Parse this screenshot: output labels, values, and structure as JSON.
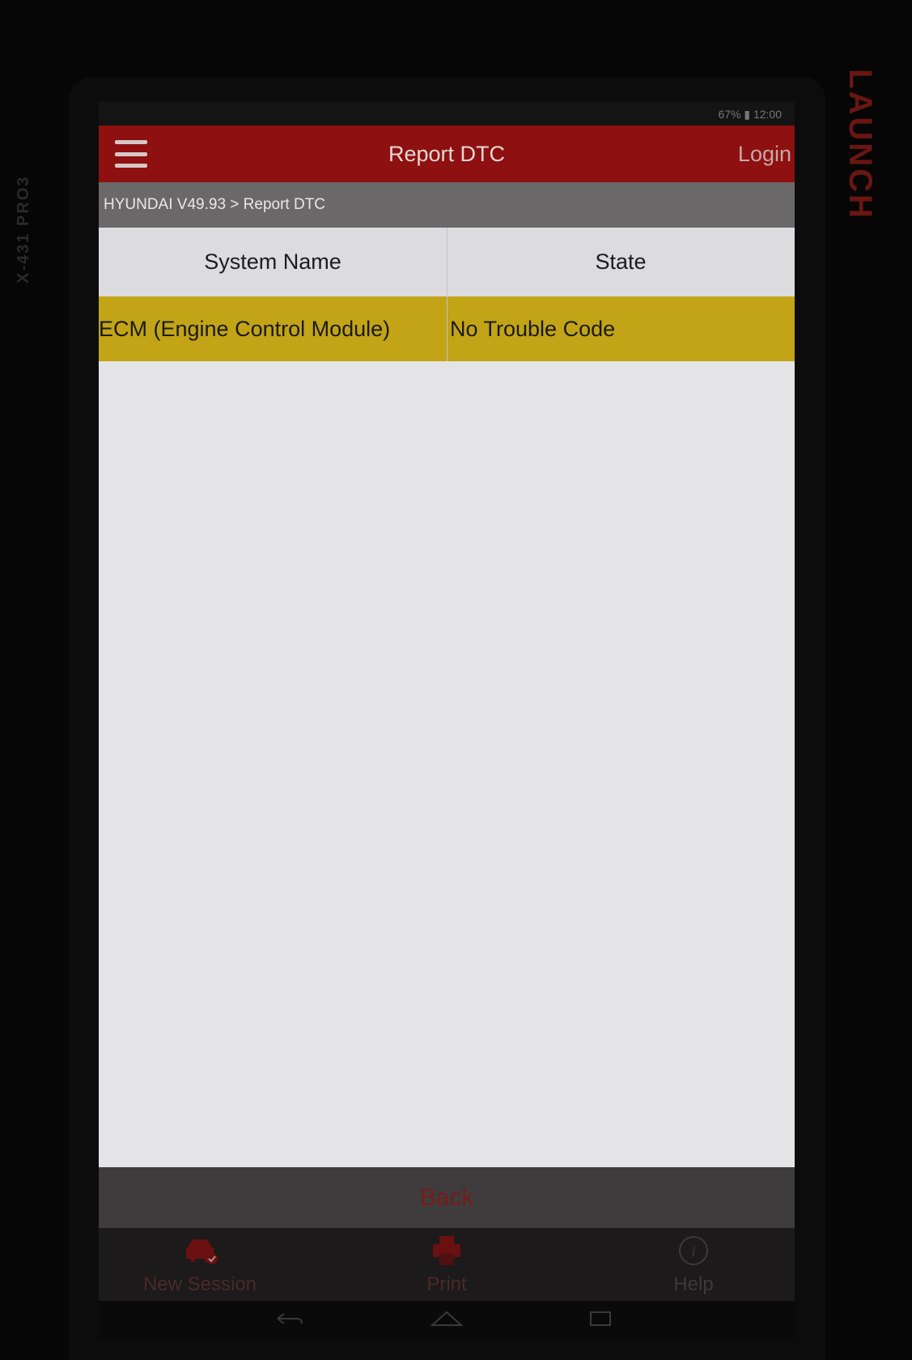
{
  "device": {
    "side_brand": "X-431 PRO3",
    "top_brand": "LAUNCH"
  },
  "statusbar": {
    "text": "67% ▮ 12:00"
  },
  "appbar": {
    "title": "Report DTC",
    "login_label": "Login"
  },
  "breadcrumb": {
    "text": "HYUNDAI V49.93 > Report DTC"
  },
  "table": {
    "headers": [
      "System Name",
      "State"
    ],
    "rows": [
      {
        "system": "ECM (Engine Control Module)",
        "state": "No Trouble Code"
      }
    ],
    "highlight_color": "#c2a416"
  },
  "back": {
    "label": "Back"
  },
  "bottom_bar": {
    "items": [
      {
        "label": "New Session",
        "icon": "car-check-icon"
      },
      {
        "label": "Print",
        "icon": "printer-icon"
      },
      {
        "label": "Help",
        "icon": "info-icon"
      }
    ]
  },
  "navbar": {
    "icons": [
      "back-nav-icon",
      "home-nav-icon",
      "recents-nav-icon"
    ]
  },
  "colors": {
    "accent": "#8e1010",
    "accent_text": "#c0202a"
  }
}
